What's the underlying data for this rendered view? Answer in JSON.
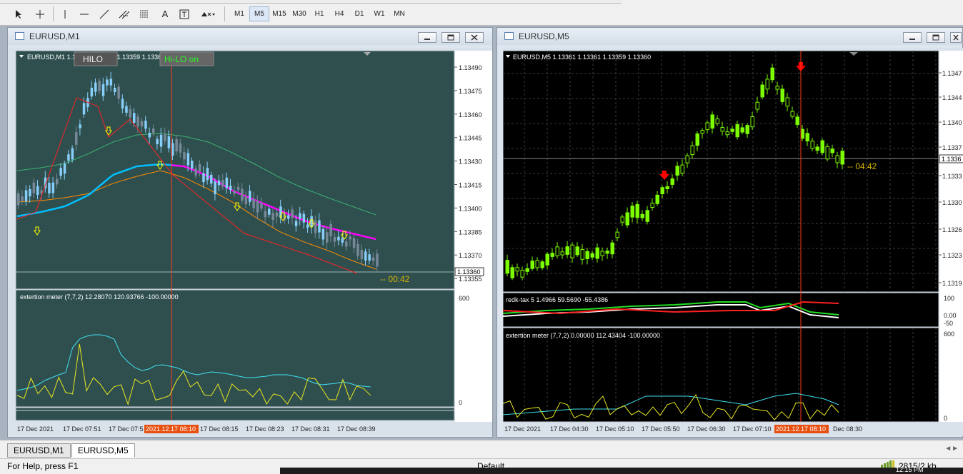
{
  "toolbar": {
    "timeframes": [
      "M1",
      "M5",
      "M15",
      "M30",
      "H1",
      "H4",
      "D1",
      "W1",
      "MN"
    ],
    "selected_timeframe": "M5"
  },
  "window_m1": {
    "title": "EURUSD,M1",
    "info": "EURUSD,M1  1.13360 1.13361 1.13359 1.13360",
    "btn_hilo": "HILO",
    "btn_hilo_on": "Hi-LO on",
    "price_labels": [
      "1.13490",
      "1.13475",
      "1.13460",
      "1.13445",
      "1.13430",
      "1.13415",
      "1.13400",
      "1.13385",
      "1.13370",
      "1.13355"
    ],
    "current_price": "1.13360",
    "countdown": "--  00:42",
    "indicator_label": "extertion meter (7,7,2) 12.28070 120.93766 -100.00000",
    "indicator_scale": [
      "600",
      "0"
    ],
    "time_labels": [
      "17 Dec 2021",
      "17 Dec 07:51",
      "17 Dec 07:5",
      "17 Dec 08:15",
      "17 Dec 08:23",
      "17 Dec 08:31",
      "17 Dec 08:39"
    ],
    "time_marker": "2021.12.17 08:10"
  },
  "window_m5": {
    "title": "EURUSD,M5",
    "info": "EURUSD,M5  1.13361 1.13361 1.13359 1.13360",
    "price_labels": [
      "1.1347",
      "1.1344",
      "1.1340",
      "1.1337",
      "1.1333",
      "1.1330",
      "1.1326",
      "1.1323",
      "1.1319"
    ],
    "current_price": "1.1336",
    "countdown": "--  04:42",
    "ind1_label": "redk-tax 5 1.4966 59.5690 -55.4386",
    "ind1_scale": [
      "100",
      "0.00",
      "-50"
    ],
    "ind2_label": "extertion meter (7,7,2) 0.00000 112.43404 -100.00000",
    "ind2_scale": [
      "600",
      "0"
    ],
    "time_labels": [
      "17 Dec 2021",
      "17 Dec 04:30",
      "17 Dec 05:10",
      "17 Dec 05:50",
      "17 Dec 06:30",
      "17 Dec 07:10",
      "Dec 08:30"
    ],
    "time_marker": "2021.12.17 08:10"
  },
  "tabs": [
    "EURUSD,M1",
    "EURUSD,M5"
  ],
  "active_tab": "EURUSD,M5",
  "status": {
    "help": "For Help, press F1",
    "profile": "Default",
    "traffic": "2815/2 kb",
    "clock": "12:15 PM"
  },
  "colors": {
    "m1_bg": "#2f4f4f",
    "m5_bg": "#000000",
    "bull_candle": "#87cefa",
    "bear_candle": "#778899",
    "m5_bull": "#7cfc00",
    "ma_fast": "#00bfff",
    "ma_trend": "#ff00ff",
    "ma_slow": "#3cb371",
    "ma_band": "#ff8c00",
    "signal_arrow": "#ffff00",
    "sell_arrow": "#ff0000",
    "countdown": "#d4b400"
  }
}
